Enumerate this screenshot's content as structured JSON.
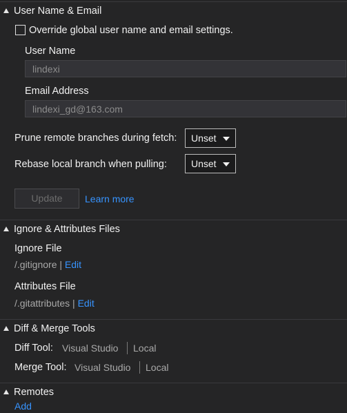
{
  "sections": {
    "user": {
      "title": "User Name & Email",
      "override_label": "Override global user name and email settings.",
      "override_checked": false,
      "user_name_label": "User Name",
      "user_name_value": "lindexi",
      "email_label": "Email Address",
      "email_value": "lindexi_gd@163.com",
      "prune_label": "Prune remote branches during fetch:",
      "prune_value": "Unset",
      "rebase_label": "Rebase local branch when pulling:",
      "rebase_value": "Unset",
      "update_label": "Update",
      "learn_more": "Learn more"
    },
    "ignore": {
      "title": "Ignore & Attributes Files",
      "ignore_file_label": "Ignore File",
      "ignore_file_path": "/.gitignore",
      "pipe": "|",
      "edit": "Edit",
      "attributes_file_label": "Attributes File",
      "attributes_file_path": "/.gitattributes"
    },
    "diff": {
      "title": "Diff & Merge Tools",
      "diff_tool_label": "Diff Tool:",
      "diff_tool_value": "Visual Studio",
      "diff_tool_scope": "Local",
      "merge_tool_label": "Merge Tool:",
      "merge_tool_value": "Visual Studio",
      "merge_tool_scope": "Local"
    },
    "remotes": {
      "title": "Remotes",
      "add": "Add"
    }
  },
  "colors": {
    "background": "#252526",
    "link": "#3794ff",
    "text": "#f1f1f1",
    "muted": "#a9a9a9"
  }
}
